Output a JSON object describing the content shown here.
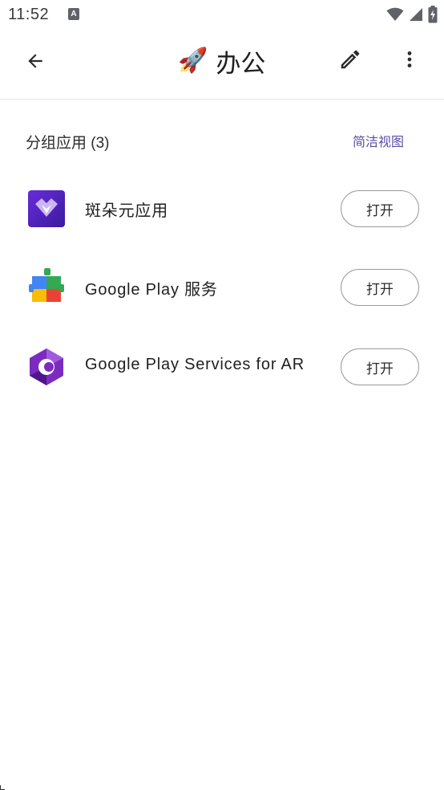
{
  "status_bar": {
    "time": "11:52",
    "notification_letter": "A",
    "icons": [
      "wifi-icon",
      "cellular-signal-icon",
      "battery-charging-icon"
    ]
  },
  "app_bar": {
    "back_icon": "arrow-back-icon",
    "title_emoji": "🚀",
    "title": "办公",
    "edit_icon": "pencil-icon",
    "more_icon": "more-vert-icon"
  },
  "section": {
    "title": "分组应用 (3)",
    "action": "简洁视图"
  },
  "apps": [
    {
      "name": "斑朵元应用",
      "button": "打开",
      "icon": "bandu-app-icon"
    },
    {
      "name": "Google Play 服务",
      "button": "打开",
      "icon": "google-play-services-icon"
    },
    {
      "name": "Google Play Services for AR",
      "button": "打开",
      "icon": "google-play-services-ar-icon"
    }
  ],
  "colors": {
    "accent": "#5b4fa6",
    "divider": "#e6e6e6",
    "button_border": "#9a9a9a"
  }
}
